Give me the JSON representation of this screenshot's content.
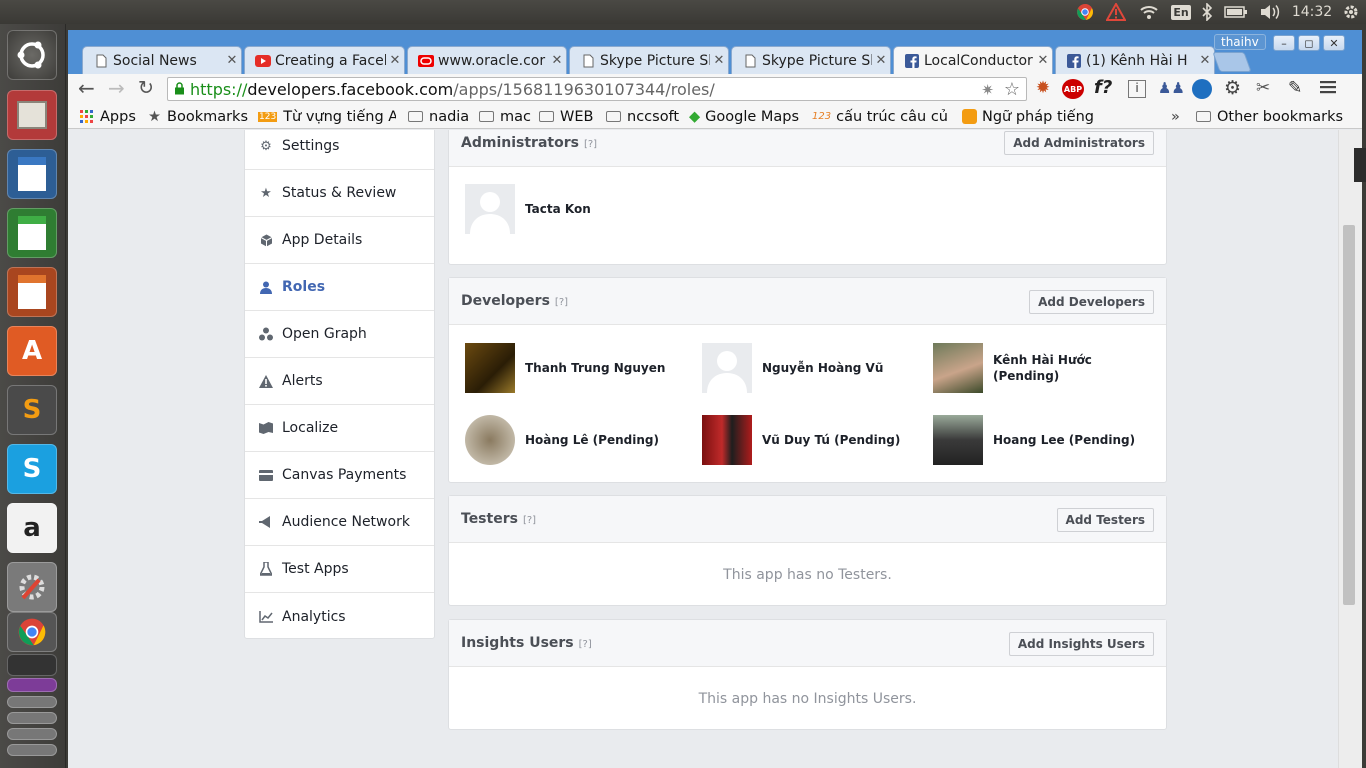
{
  "system": {
    "keyboard": "En",
    "time": "14:32",
    "user": "thaihv"
  },
  "tabs": [
    {
      "title": "Social News"
    },
    {
      "title": "Creating a Facel"
    },
    {
      "title": "www.oracle.cor"
    },
    {
      "title": "Skype Picture Sl"
    },
    {
      "title": "Skype Picture Sl"
    },
    {
      "title": "LocalConductor"
    },
    {
      "title": "(1) Kênh Hài H"
    }
  ],
  "address": {
    "scheme": "https://",
    "host": "developers.facebook.com",
    "path": "/apps/1568119630107344/roles/"
  },
  "bookmarks": {
    "apps": "Apps",
    "bookmarks": "Bookmarks",
    "items": [
      "Từ vựng tiếng A",
      "nadia",
      "mac",
      "WEB",
      "nccsoft",
      "Google Maps",
      "cấu trúc câu củ",
      "Ngữ pháp tiếng"
    ],
    "overflow": "»",
    "other": "Other bookmarks"
  },
  "nav": [
    {
      "label": "Settings"
    },
    {
      "label": "Status & Review"
    },
    {
      "label": "App Details"
    },
    {
      "label": "Roles"
    },
    {
      "label": "Open Graph"
    },
    {
      "label": "Alerts"
    },
    {
      "label": "Localize"
    },
    {
      "label": "Canvas Payments"
    },
    {
      "label": "Audience Network"
    },
    {
      "label": "Test Apps"
    },
    {
      "label": "Analytics"
    }
  ],
  "administrators": {
    "title": "Administrators",
    "help": "[?]",
    "button": "Add Administrators",
    "people": [
      {
        "name": "Tacta Kon"
      }
    ]
  },
  "developers": {
    "title": "Developers",
    "help": "[?]",
    "button": "Add Developers",
    "people": [
      {
        "name": "Thanh Trung Nguyen"
      },
      {
        "name": "Nguyễn Hoàng Vũ"
      },
      {
        "name": "Kênh Hài Hước",
        "status": "(Pending)"
      },
      {
        "name": "Hoàng Lê (Pending)"
      },
      {
        "name": "Vũ Duy Tú (Pending)"
      },
      {
        "name": "Hoang Lee (Pending)"
      }
    ]
  },
  "testers": {
    "title": "Testers",
    "help": "[?]",
    "button": "Add Testers",
    "empty": "This app has no Testers."
  },
  "insights": {
    "title": "Insights Users",
    "help": "[?]",
    "button": "Add Insights Users",
    "empty": "This app has no Insights Users."
  }
}
